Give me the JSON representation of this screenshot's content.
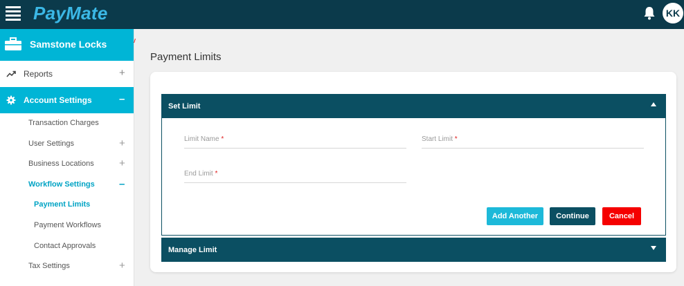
{
  "app": {
    "logo": "PayMate"
  },
  "user": {
    "initials": "KK"
  },
  "sidebar": {
    "org_name": "Samstone Locks",
    "reports_label": "Reports",
    "account_settings_label": "Account Settings",
    "sub_items": [
      {
        "label": "Transaction Charges"
      },
      {
        "label": "User Settings"
      },
      {
        "label": "Business Locations"
      },
      {
        "label": "Workflow Settings"
      },
      {
        "label": "Payment Limits"
      },
      {
        "label": "Payment Workflows"
      },
      {
        "label": "Contact Approvals"
      },
      {
        "label": "Tax Settings"
      }
    ],
    "plus": "+",
    "minus": "–"
  },
  "main": {
    "page_title": "Payment Limits",
    "set_limit": {
      "title": "Set Limit",
      "fields": {
        "limit_name": {
          "label": "Limit Name",
          "value": ""
        },
        "start_limit": {
          "label": "Start Limit",
          "value": ""
        },
        "end_limit": {
          "label": "End Limit",
          "value": ""
        }
      },
      "required_mark": "*",
      "add_another_label": "Add Another",
      "continue_label": "Continue",
      "cancel_label": "Cancel"
    },
    "manage_limit": {
      "title": "Manage Limit"
    }
  },
  "colors": {
    "topbar": "#0b3a4b",
    "accent": "#00b5d6",
    "panel": "#0b4f62",
    "danger": "#f50000"
  },
  "icons": {
    "menu": "hamburger-menu-icon",
    "notifications": "bell-icon",
    "org": "briefcase-icon",
    "reports": "trending-up-icon",
    "account_settings": "gear-icon",
    "collapse": "caret-up-icon",
    "expand": "caret-down-icon"
  }
}
